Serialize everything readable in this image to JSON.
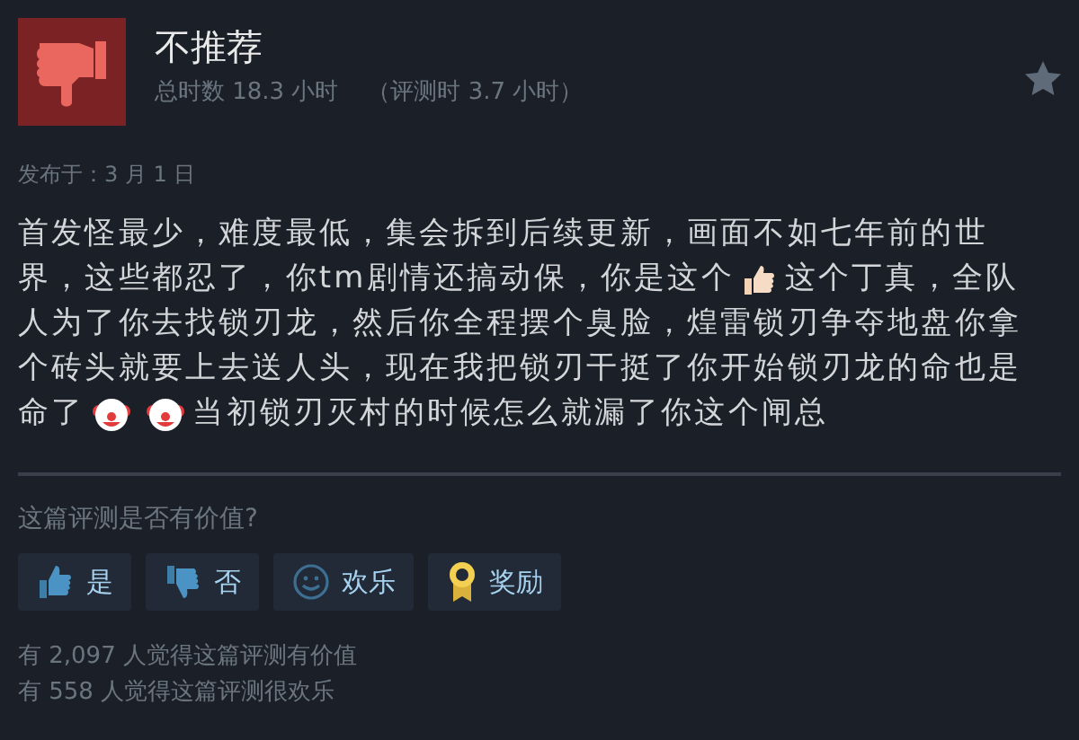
{
  "review": {
    "verdict": "不推荐",
    "hours": "总时数 18.3 小时",
    "review_hours": "（评测时 3.7 小时）",
    "posted": "发布于：3 月 1 日",
    "body": [
      [
        {
          "kind": "text",
          "text": "首发怪最少，难度最低，集会拆到后续更新，画面不如七年前的世"
        }
      ],
      [
        {
          "kind": "text",
          "text": "界，这些都忍了，你tm剧情还搞动保，你是这个"
        },
        {
          "kind": "thumbs"
        },
        {
          "kind": "text",
          "text": "这个丁真，全队"
        }
      ],
      [
        {
          "kind": "text",
          "text": "人为了你去找锁刃龙，然后你全程摆个臭脸，煌雷锁刃争夺地盘你拿"
        }
      ],
      [
        {
          "kind": "text",
          "text": "个砖头就要上去送人头，现在我把锁刃干挺了你开始锁刃龙的命也是"
        }
      ],
      [
        {
          "kind": "text",
          "text": "命了"
        },
        {
          "kind": "clown"
        },
        {
          "kind": "clown"
        },
        {
          "kind": "text",
          "text": "当初锁刃灭村的时候怎么就漏了你这个闸总"
        }
      ]
    ]
  },
  "helpful": {
    "question": "这篇评测是否有价值?",
    "buttons": [
      {
        "kind": "yes",
        "label": "是"
      },
      {
        "kind": "no",
        "label": "否"
      },
      {
        "kind": "funny",
        "label": "欢乐"
      },
      {
        "kind": "award",
        "label": "奖励"
      }
    ],
    "counts": [
      "有 2,097 人觉得这篇评测有价值",
      "有 558 人觉得这篇评测很欢乐"
    ]
  }
}
